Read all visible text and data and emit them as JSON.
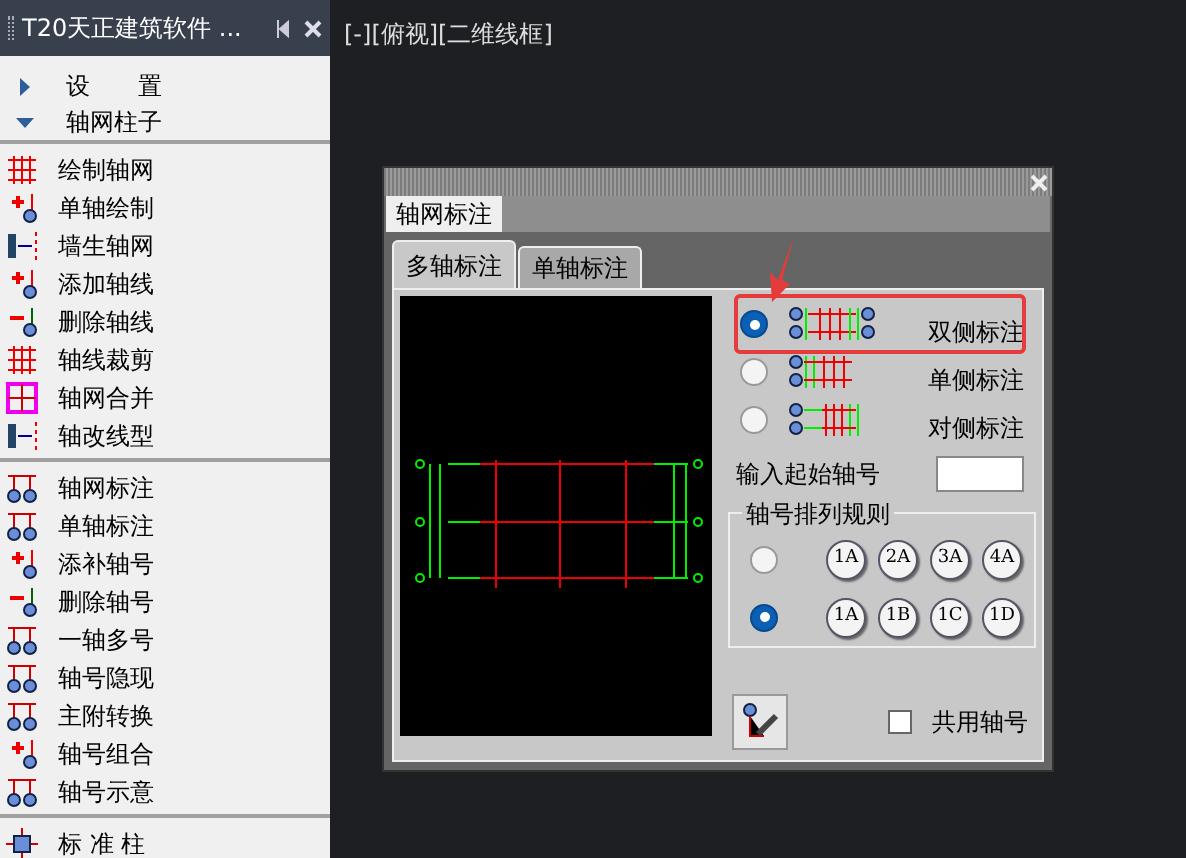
{
  "panel": {
    "title": "T20天正建筑软件 ...",
    "sections": [
      {
        "label": "设　　置",
        "expanded": false
      },
      {
        "label": "轴网柱子",
        "expanded": true
      }
    ],
    "groups": [
      [
        {
          "label": "绘制轴网",
          "kind": "grid"
        },
        {
          "label": "单轴绘制",
          "kind": "add"
        },
        {
          "label": "墙生轴网",
          "kind": "wall"
        },
        {
          "label": "添加轴线",
          "kind": "add"
        },
        {
          "label": "删除轴线",
          "kind": "remove"
        },
        {
          "label": "轴线裁剪",
          "kind": "grid"
        },
        {
          "label": "轴网合并",
          "kind": "merge"
        },
        {
          "label": "轴改线型",
          "kind": "wall"
        }
      ],
      [
        {
          "label": "轴网标注",
          "kind": "bubble"
        },
        {
          "label": "单轴标注",
          "kind": "bubble"
        },
        {
          "label": "添补轴号",
          "kind": "add"
        },
        {
          "label": "删除轴号",
          "kind": "remove"
        },
        {
          "label": "一轴多号",
          "kind": "bubble"
        },
        {
          "label": "轴号隐现",
          "kind": "bubble"
        },
        {
          "label": "主附转换",
          "kind": "bubble"
        },
        {
          "label": "轴号组合",
          "kind": "add"
        },
        {
          "label": "轴号示意",
          "kind": "bubble"
        }
      ],
      [
        {
          "label": "标 准 柱",
          "kind": "column"
        }
      ]
    ]
  },
  "canvas": {
    "view_label": "[-][俯视][二维线框]"
  },
  "dialog": {
    "outer_tabs": [
      {
        "label": "轴网标注",
        "selected": true
      }
    ],
    "tabs": [
      {
        "label": "多轴标注",
        "selected": true
      },
      {
        "label": "单轴标注",
        "selected": false
      }
    ],
    "options": [
      {
        "label": "双侧标注",
        "selected": true,
        "kind": "both"
      },
      {
        "label": "单侧标注",
        "selected": false,
        "kind": "single"
      },
      {
        "label": "对侧标注",
        "selected": false,
        "kind": "opposite"
      }
    ],
    "start_axis": {
      "label": "输入起始轴号"
    },
    "rule": {
      "title": "轴号排列规则",
      "rows": [
        {
          "selected": false,
          "bubbles": [
            "1A",
            "2A",
            "3A",
            "4A"
          ]
        },
        {
          "selected": true,
          "bubbles": [
            "1A",
            "1B",
            "1C",
            "1D"
          ]
        }
      ]
    },
    "shared": {
      "label": "共用轴号",
      "checked": false
    }
  }
}
